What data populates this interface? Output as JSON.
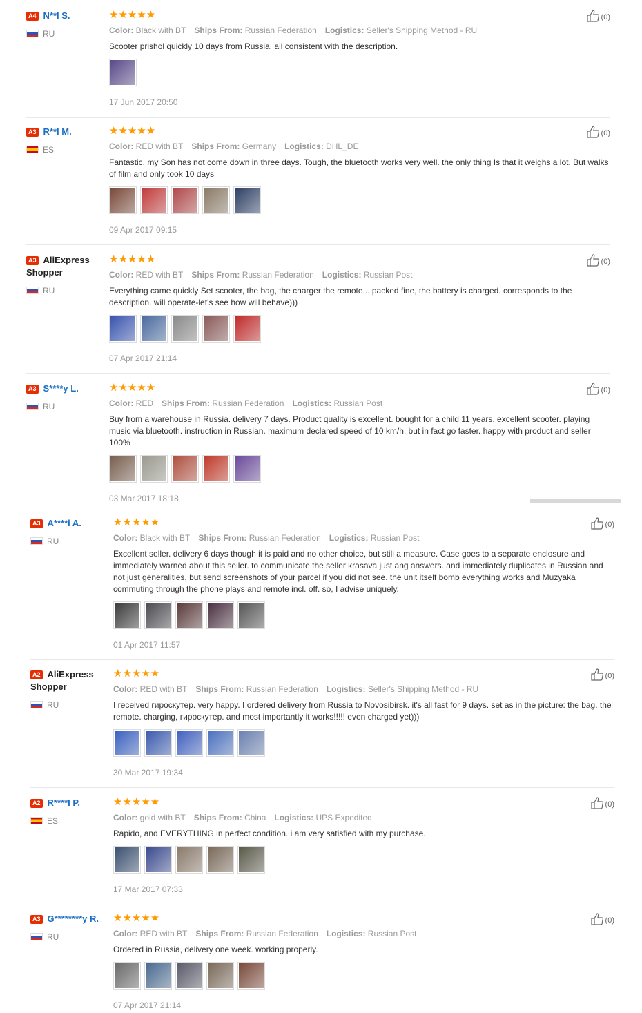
{
  "labels": {
    "color": "Color:",
    "ships_from": "Ships From:",
    "logistics": "Logistics:",
    "stars": "★★★★★"
  },
  "reviews": [
    {
      "level": "A4",
      "name": "N**I S.",
      "country": "RU",
      "flag": "ru",
      "color": "Black with BT",
      "ships_from": "Russian Federation",
      "logistics": "Seller's Shipping Method - RU",
      "text": "Scooter prishol quickly 10 days from Russia. all consistent with the description.",
      "photos": [
        "#5a4a8a"
      ],
      "date": "17 Jun 2017 20:50",
      "likes": "(0)"
    },
    {
      "level": "A3",
      "name": "R**I M.",
      "country": "ES",
      "flag": "es",
      "color": "RED with BT",
      "ships_from": "Germany",
      "logistics": "DHL_DE",
      "text": "Fantastic, my Son has not come down in three days. Tough, the bluetooth works very well. the only thing Is that it weighs a lot. But walks of film and only took 10 days",
      "photos": [
        "#7a4a3a",
        "#c23a3a",
        "#b04848",
        "#8a7a66",
        "#2c3e64"
      ],
      "date": "09 Apr 2017 09:15",
      "likes": "(0)"
    },
    {
      "level": "A3",
      "name": "AliExpress Shopper",
      "country": "RU",
      "flag": "ru",
      "color": "RED with BT",
      "ships_from": "Russian Federation",
      "logistics": "Russian Post",
      "text": "Everything came quickly Set scooter, the bag, the charger the remote... packed fine, the battery is charged. corresponds to the description. will operate-let's see how will behave)))",
      "photos": [
        "#3a55b0",
        "#4a6aa0",
        "#8a8a8a",
        "#8a5a5a",
        "#c02a2a"
      ],
      "date": "07 Apr 2017 21:14",
      "likes": "(0)"
    },
    {
      "level": "A3",
      "name": "S****y L.",
      "country": "RU",
      "flag": "ru",
      "color": "RED",
      "ships_from": "Russian Federation",
      "logistics": "Russian Post",
      "text": "Buy from a warehouse in Russia. delivery 7 days. Product quality is excellent. bought for a child 11 years. excellent scooter. playing music via bluetooth. instruction in Russian. maximum declared speed of 10 km/h, but in fact go faster. happy with product and seller 100%",
      "photos": [
        "#7a6050",
        "#9a9a90",
        "#b05040",
        "#c03a2a",
        "#6a4a9a"
      ],
      "date": "03 Mar 2017 18:18",
      "likes": "(0)"
    },
    {
      "level": "A3",
      "name": "A****i A.",
      "country": "RU",
      "flag": "ru",
      "color": "Black with BT",
      "ships_from": "Russian Federation",
      "logistics": "Russian Post",
      "text": "Excellent seller. delivery 6 days though it is paid and no other choice, but still a measure. Case goes to a separate enclosure and immediately warned about this seller. to communicate the seller krasava just ang answers. and immediately duplicates in Russian and not just generalities, but send screenshots of your parcel if you did not see. the unit itself bomb everything works and Muzyaka commuting through the phone plays and remote incl. off. so, I advise uniquely.",
      "photos": [
        "#3a3a3a",
        "#4a4a50",
        "#5a3a3a",
        "#4a3040",
        "#555555"
      ],
      "date": "01 Apr 2017 11:57",
      "likes": "(0)"
    },
    {
      "level": "A2",
      "name": "AliExpress Shopper",
      "country": "RU",
      "flag": "ru",
      "color": "RED with BT",
      "ships_from": "Russian Federation",
      "logistics": "Seller's Shipping Method - RU",
      "text": "I received гироскутер. very happy. I ordered delivery from Russia to Novosibirsk. it's all fast for 9 days. set as in the picture: the bag. the remote. charging, гироскутер. and most importantly it works!!!!! even charged yet)))",
      "photos": [
        "#3a60c0",
        "#3a5ab0",
        "#4060c0",
        "#4a70c0",
        "#6a80b0"
      ],
      "date": "30 Mar 2017 19:34",
      "likes": "(0)"
    },
    {
      "level": "A2",
      "name": "R****I P.",
      "country": "ES",
      "flag": "es",
      "color": "gold with BT",
      "ships_from": "China",
      "logistics": "UPS Expedited",
      "text": "Rapido, and EVERYTHING in perfect condition. i am very satisfied with my purchase.",
      "photos": [
        "#3a5070",
        "#3a4a90",
        "#8a7a6a",
        "#7a6a5a",
        "#5a5a4a"
      ],
      "date": "17 Mar 2017 07:33",
      "likes": "(0)"
    },
    {
      "level": "A3",
      "name": "G********y R.",
      "country": "RU",
      "flag": "ru",
      "color": "RED with BT",
      "ships_from": "Russian Federation",
      "logistics": "Russian Post",
      "text": "Ordered in Russia, delivery one week. working properly.",
      "photos": [
        "#6a6a6a",
        "#4a6a90",
        "#5a5a6a",
        "#7a6a5a",
        "#7a4a3a"
      ],
      "date": "07 Apr 2017 21:14",
      "likes": "(0)"
    }
  ]
}
